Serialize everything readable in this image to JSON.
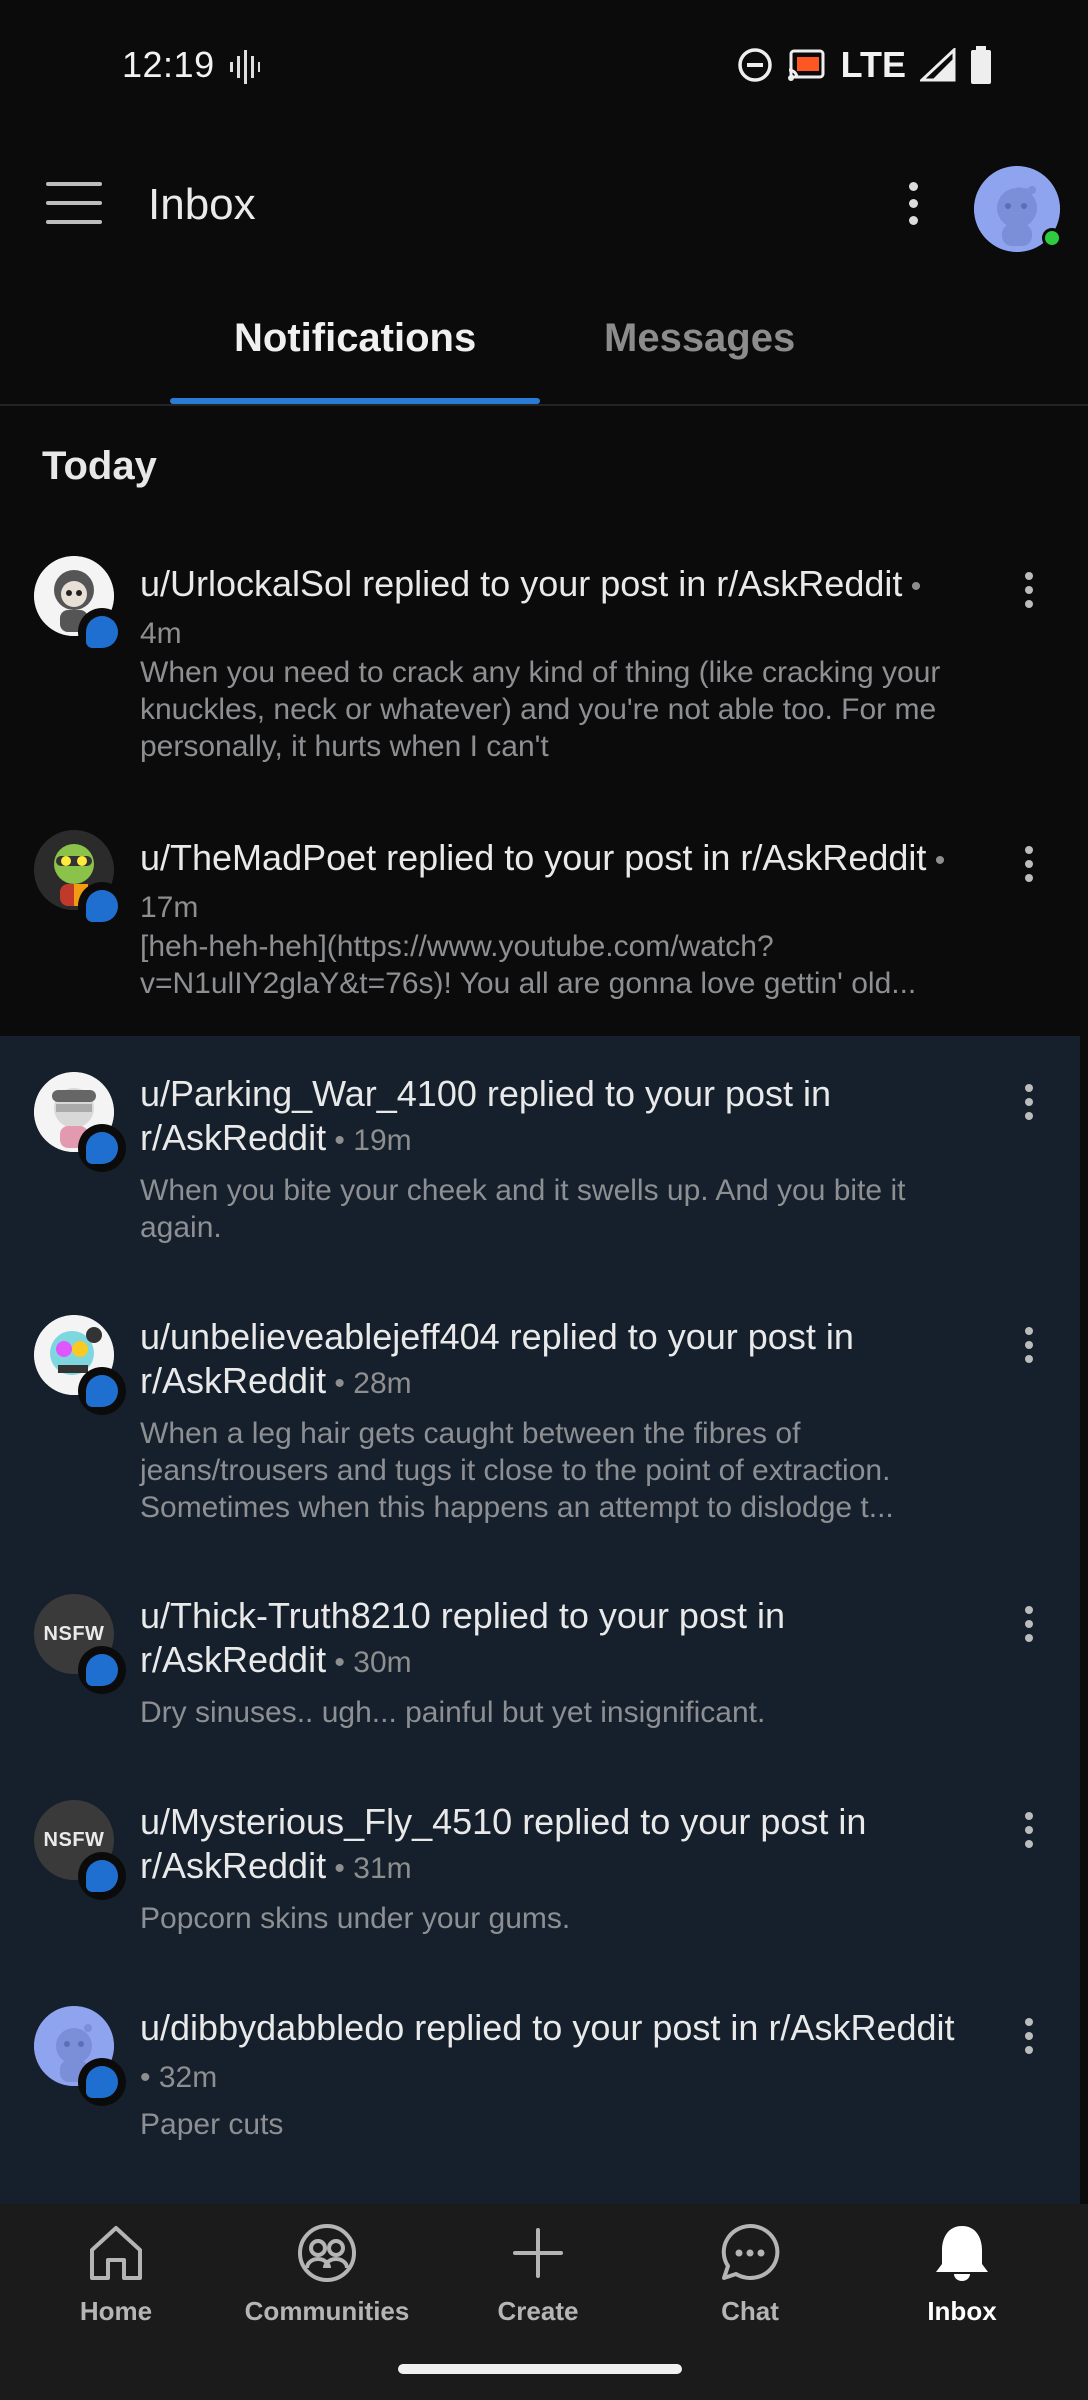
{
  "status_bar": {
    "time": "12:19",
    "network": "LTE"
  },
  "app_bar": {
    "title": "Inbox"
  },
  "tabs": [
    {
      "label": "Notifications"
    },
    {
      "label": "Messages"
    }
  ],
  "section": {
    "header": "Today"
  },
  "notifications": [
    {
      "user": "u/UrlockalSol",
      "action": " replied to your post in ",
      "sub": "r/AskReddit",
      "time": "4m",
      "body": "When you need to crack any kind of thing (like cracking your knuckles, neck or whatever) and you're not able too. For me personally, it hurts when I can't",
      "avatar": "snoo-hooded",
      "unread": false
    },
    {
      "user": "u/TheMadPoet",
      "action": " replied to your post in ",
      "sub": "r/AskReddit",
      "time": "17m",
      "body": "[heh-heh-heh](https://www.youtube.com/watch?v=N1ulIY2glaY&t=76s)! You all are gonna love gettin' old...",
      "avatar": "snoo-goggles",
      "unread": false
    },
    {
      "user": "u/Parking_War_4100",
      "action": " replied to your post in ",
      "sub": "r/AskReddit",
      "time": "19m",
      "body": "When you bite your cheek and it swells up. And you bite it again.",
      "avatar": "snoo-cap",
      "unread": true
    },
    {
      "user": "u/unbelieveablejeff404",
      "action": " replied to your post in ",
      "sub": "r/AskReddit",
      "time": "28m",
      "body": "When a leg hair gets caught between the fibres of jeans/trousers and tugs it close to the point of extraction. Sometimes when this happens an attempt to dislodge t...",
      "avatar": "snoo-colorful",
      "unread": true
    },
    {
      "user": "u/Thick-Truth8210",
      "action": " replied to your post in ",
      "sub": "r/AskReddit",
      "time": "30m",
      "body": "Dry sinuses.. ugh... painful but yet insignificant.",
      "avatar": "NSFW",
      "unread": true
    },
    {
      "user": "u/Mysterious_Fly_4510",
      "action": " replied to your post in ",
      "sub": "r/AskReddit",
      "time": "31m",
      "body": "Popcorn skins under your gums.",
      "avatar": "NSFW",
      "unread": true
    },
    {
      "user": "u/dibbydabbledo",
      "action": " replied to your post in ",
      "sub": "r/AskReddit",
      "time": "32m",
      "body": "Paper cuts",
      "avatar": "snoo-default",
      "unread": true
    }
  ],
  "bottom_nav": [
    {
      "label": "Home",
      "icon": "home-icon"
    },
    {
      "label": "Communities",
      "icon": "communities-icon"
    },
    {
      "label": "Create",
      "icon": "plus-icon"
    },
    {
      "label": "Chat",
      "icon": "chat-icon"
    },
    {
      "label": "Inbox",
      "icon": "bell-icon",
      "active": true
    }
  ],
  "colors": {
    "accent": "#2a7bd3",
    "unread_bg": "#15202c",
    "badge": "#1f6fd1",
    "online": "#2ecc40"
  }
}
